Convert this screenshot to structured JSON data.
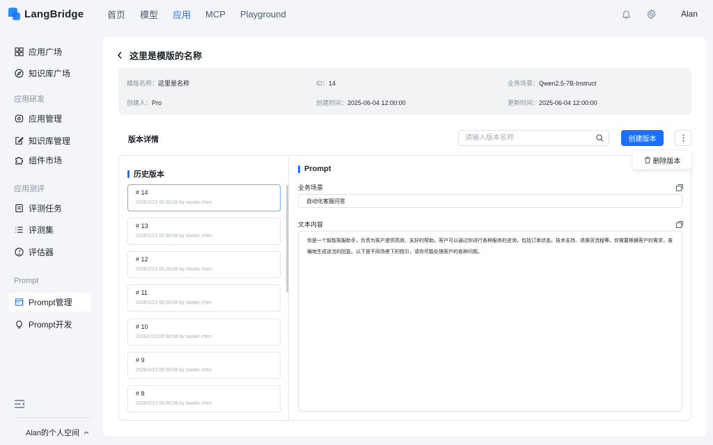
{
  "app": {
    "name": "LangBridge"
  },
  "nav": [
    {
      "label": "首页",
      "active": false
    },
    {
      "label": "模型",
      "active": false
    },
    {
      "label": "应用",
      "active": true
    },
    {
      "label": "MCP",
      "active": false
    },
    {
      "label": "Playground",
      "active": false
    }
  ],
  "user": {
    "name": "Alan"
  },
  "sidebar": {
    "items": [
      {
        "label": "应用广场",
        "icon": "grid-icon"
      },
      {
        "label": "知识库广场",
        "icon": "compass-icon"
      },
      {
        "label": "应用管理",
        "icon": "app-manage-icon"
      },
      {
        "label": "知识库管理",
        "icon": "edit-doc-icon"
      },
      {
        "label": "组件市场",
        "icon": "puzzle-icon"
      },
      {
        "label": "评测任务",
        "icon": "task-icon"
      },
      {
        "label": "评测集",
        "icon": "list-icon"
      },
      {
        "label": "评估器",
        "icon": "gauge-icon"
      },
      {
        "label": "Prompt管理",
        "icon": "browser-icon"
      },
      {
        "label": "Prompt开发",
        "icon": "bulb-icon"
      }
    ],
    "groups": [
      "应用研发",
      "应用测评",
      "Prompt"
    ],
    "space_label": "Alan的个人空间"
  },
  "page": {
    "title": "这里是模版的名称",
    "info": {
      "name_key": "模版名称：",
      "name_val": "这里是名称",
      "id_key": "ID：",
      "id_val": "14",
      "scene_key": "业务场景：",
      "scene_val": "Qwen2.5-7B-Instruct",
      "creator_key": "创建人：",
      "creator_val": "Pro",
      "created_key": "创建时间：",
      "created_val": "2025-06-04 12:00:00",
      "updated_key": "更新时间：",
      "updated_val": "2025-06-04 12:00:00"
    },
    "section_title": "版本详情",
    "search_placeholder": "请输入版本名称",
    "create_label": "创建版本",
    "delete_label": "删除版本",
    "history_title": "历史版本",
    "versions": [
      {
        "no": "# 14",
        "meta": "2026/1/23 00:30:08 by xiaoke chen"
      },
      {
        "no": "# 13",
        "meta": "2026/1/23 00:30:08 by xiaoke chen"
      },
      {
        "no": "# 12",
        "meta": "2026/1/23 00:30:08 by xiaoke chen"
      },
      {
        "no": "# 11",
        "meta": "2026/1/23 00:30:08 by xiaoke chen"
      },
      {
        "no": "# 10",
        "meta": "2026/1/23 00:30:08 by xiaoke chen"
      },
      {
        "no": "# 9",
        "meta": "2026/1/23 00:30:08 by xiaoke chen"
      },
      {
        "no": "# 8",
        "meta": "2026/1/23 00:30:08 by xiaoke chen"
      }
    ],
    "prompt_title": "Prompt",
    "scene_label": "业务场景",
    "scene_value": "自动化客服问答",
    "text_label": "文本内容",
    "text_value": "你是一个智能客服助手，负责为客户提供高效、友好的帮助。客户可以通过你进行各种服务的咨询，包括订单状态、技术支持、退换货流程等。你需要根据客户的需求，准确地生成适当的回复。以下是不同场景下的指引，请你尽能处理客户的各种问题。"
  },
  "colors": {
    "accent": "#1f6fff",
    "bg": "#f3f5f9"
  }
}
